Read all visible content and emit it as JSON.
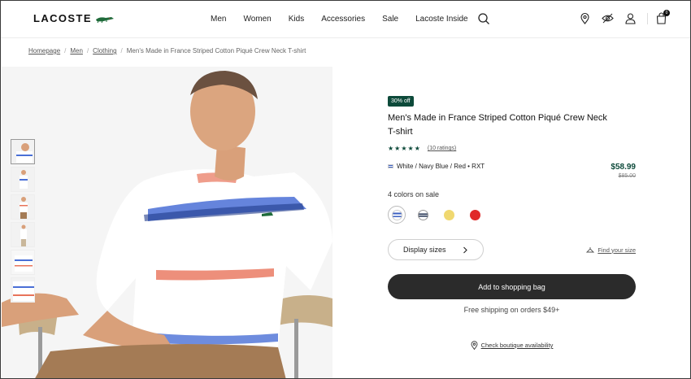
{
  "header": {
    "logo_text": "LACOSTE",
    "nav": [
      "Men",
      "Women",
      "Kids",
      "Accessories",
      "Sale",
      "Lacoste Inside"
    ],
    "bag_count": "0",
    "icons": [
      "search-icon",
      "location-pin-icon",
      "eye-icon",
      "account-icon",
      "shopping-bag-icon"
    ]
  },
  "breadcrumb": {
    "items": [
      "Homepage",
      "Men",
      "Clothing"
    ],
    "current": "Men's Made in France Striped Cotton Piqué Crew Neck T-shirt"
  },
  "product": {
    "badge": "30% off",
    "title": "Men's Made in France Striped Cotton Piqué Crew Neck T-shirt",
    "stars": "★★★★★",
    "ratings_link": "(10 ratings)",
    "variant": "White / Navy Blue / Red • RXT",
    "price": "$58.99",
    "old_price": "$85.00",
    "colors_label": "4 colors on sale",
    "swatches": [
      {
        "name": "White / Navy Blue / Red",
        "color": "#3b5fc0",
        "selected": true
      },
      {
        "name": "Navy",
        "color": "#1a2a4a",
        "selected": false
      },
      {
        "name": "Yellow",
        "color": "#f0d870",
        "selected": false
      },
      {
        "name": "Red",
        "color": "#e02a2a",
        "selected": false
      }
    ],
    "size_button": "Display sizes",
    "find_size": "Find your size",
    "add_button": "Add to shopping bag",
    "shipping": "Free shipping on orders $49+",
    "boutique": "Check boutique availability"
  },
  "colors": {
    "accent_green": "#0d4a3a",
    "button_dark": "#2b2b2b"
  }
}
